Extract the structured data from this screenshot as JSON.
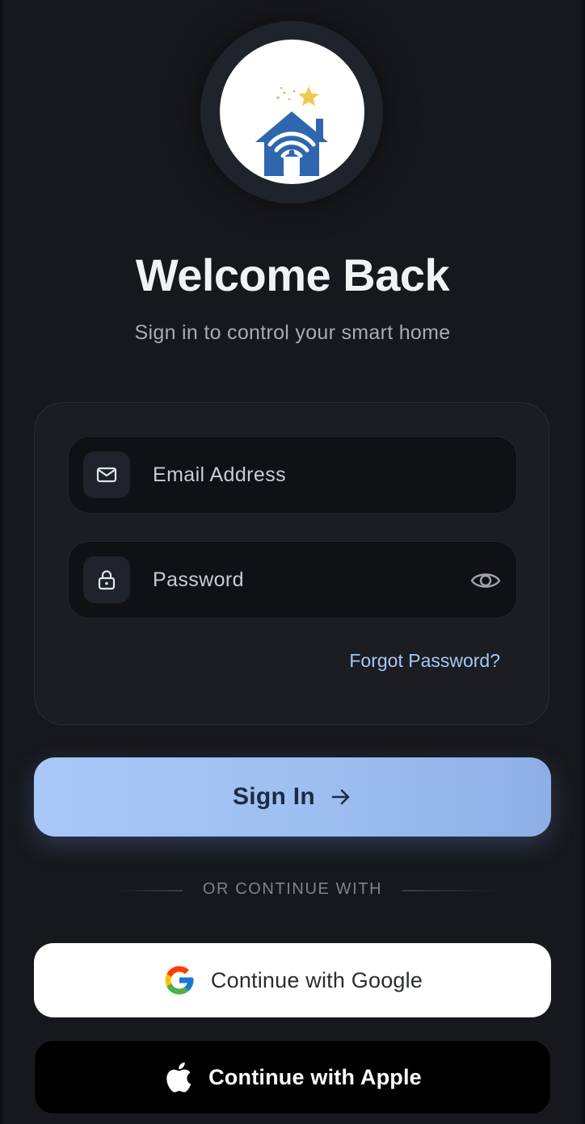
{
  "app": {
    "title": "Welcome Back",
    "subtitle": "Sign in to control your smart home"
  },
  "logo": {
    "icon": "smart-home-wifi-logo",
    "house_color": "#2f66b0",
    "star_color": "#f2c94c"
  },
  "form": {
    "email": {
      "icon": "mail-icon",
      "placeholder": "Email Address",
      "value": ""
    },
    "password": {
      "icon": "lock-icon",
      "placeholder": "Password",
      "value": "",
      "toggle_icon": "eye-icon"
    },
    "forgot_label": "Forgot Password?"
  },
  "signin": {
    "label": "Sign In",
    "icon": "arrow-right-icon"
  },
  "divider": {
    "label": "OR CONTINUE WITH"
  },
  "social": {
    "google": {
      "label": "Continue with Google",
      "icon": "google-icon"
    },
    "apple": {
      "label": "Continue with Apple",
      "icon": "apple-icon"
    }
  },
  "colors": {
    "background": "#16181d",
    "accent": "#a9c7f7",
    "link": "#a9c6f5"
  }
}
